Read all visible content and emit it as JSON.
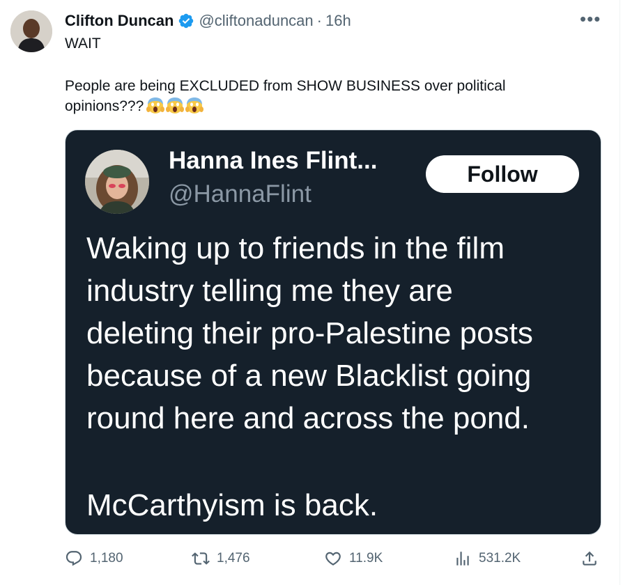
{
  "tweet": {
    "author": {
      "name": "Clifton Duncan",
      "handle": "@cliftonaduncan",
      "separator": "·",
      "time": "16h",
      "verified": true
    },
    "more_icon": "more-horizontal-icon",
    "text_line1": "WAIT",
    "text_line2": "People are being EXCLUDED from SHOW BUSINESS over political opinions???",
    "emojis": [
      "screaming-face",
      "screaming-face",
      "screaming-face"
    ]
  },
  "quoted": {
    "name": "Hanna Ines Flint...",
    "handle": "@HannaFlint",
    "follow_label": "Follow",
    "paragraph1": [
      "Waking up to friends in the film",
      "industry telling me they are",
      "deleting their pro-Palestine posts",
      "because of a new Blacklist going",
      "round here and across the pond."
    ],
    "paragraph2": "McCarthyism is back."
  },
  "actions": {
    "replies": "1,180",
    "retweets": "1,476",
    "likes": "11.9K",
    "views": "531.2K"
  },
  "colors": {
    "accent": "#1d9bf0",
    "quote_bg": "#15202b",
    "muted": "#536471"
  }
}
